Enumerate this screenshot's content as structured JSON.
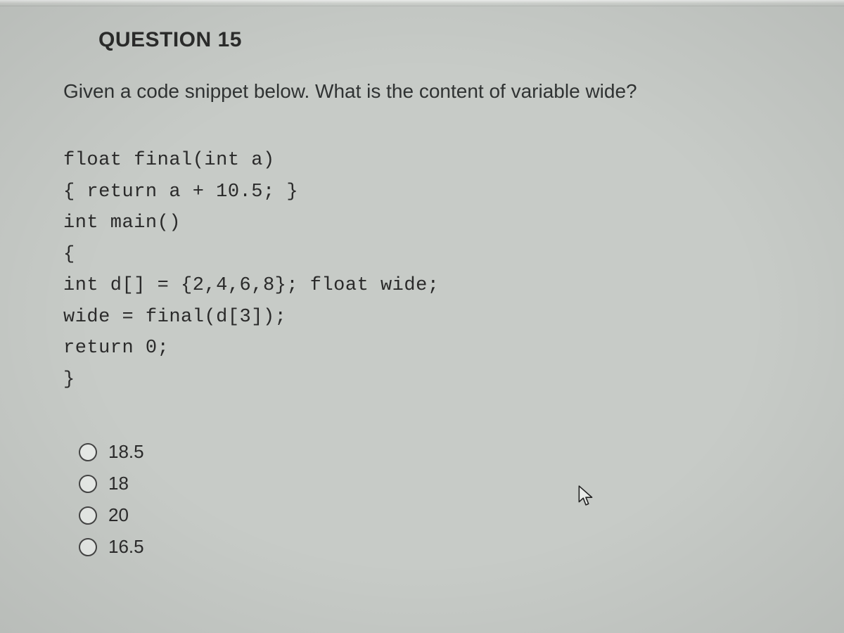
{
  "question": {
    "title": "QUESTION 15",
    "prompt": "Given a code snippet below. What is the content of variable wide?",
    "code_lines": [
      "float final(int a)",
      "{ return a + 10.5; }",
      "int main()",
      "{",
      "int d[] = {2,4,6,8}; float wide;",
      "wide = final(d[3]);",
      "return 0;",
      "}"
    ],
    "options": [
      {
        "label": "18.5",
        "selected": false
      },
      {
        "label": "18",
        "selected": false
      },
      {
        "label": "20",
        "selected": false
      },
      {
        "label": "16.5",
        "selected": false
      }
    ]
  },
  "icons": {
    "cursor": "cursor-icon"
  }
}
